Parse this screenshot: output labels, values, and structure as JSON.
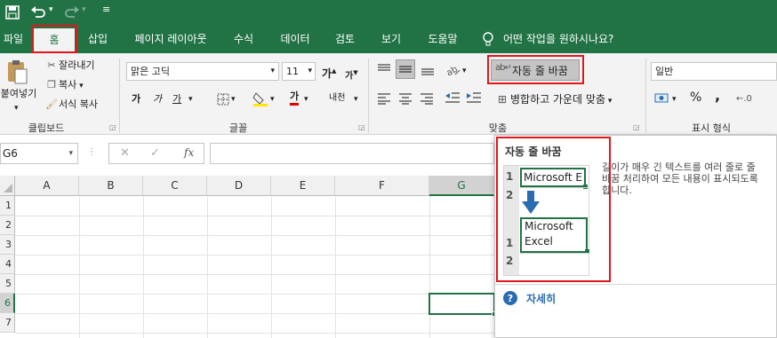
{
  "tabs": {
    "file": "파일",
    "home": "홈",
    "insert": "삽입",
    "page_layout": "페이지 레이아웃",
    "formulas": "수식",
    "data": "데이터",
    "review": "검토",
    "view": "보기",
    "help": "도움말",
    "tell_me": "어떤 작업을 원하시나요?"
  },
  "clipboard": {
    "paste": "붙여넣기",
    "cut": "잘라내기",
    "copy": "복사",
    "format_painter": "서식 복사",
    "label": "클립보드"
  },
  "font": {
    "name": "맑은 고딕",
    "size": "11",
    "bold": "가",
    "italic": "가",
    "underline": "가",
    "font_color_glyph": "가",
    "phonetic": "내천",
    "grow": "가",
    "shrink": "가",
    "label": "글꼴"
  },
  "alignment": {
    "wrap_text": "자동 줄 바꿈",
    "merge_center": "병합하고 가운데 맞춤",
    "label": "맞춤"
  },
  "number": {
    "format": "일반",
    "percent": "%",
    "comma": ",",
    "label": "표시 형식"
  },
  "formula_bar": {
    "name_box": "G6",
    "fx": "fx"
  },
  "columns": [
    "A",
    "B",
    "C",
    "D",
    "E",
    "F",
    "G"
  ],
  "rows": [
    "1",
    "2",
    "3",
    "4",
    "5",
    "6",
    "7"
  ],
  "tooltip": {
    "title": "자동 줄 바꿈",
    "description": "길이가 매우 긴 텍스트를 여러 줄로 줄바꿈 처리하여 모든 내용이 표시되도록 합니다.",
    "before_row1": "1",
    "before_row2": "2",
    "before_text": "Microsoft E",
    "after_row1": "1",
    "after_row2": "2",
    "after_line1": "Microsoft",
    "after_line2": "Excel",
    "more": "자세히"
  },
  "colors": {
    "brand": "#217346",
    "highlight": "#e0161c",
    "ribbon": "#f3f3f3"
  }
}
